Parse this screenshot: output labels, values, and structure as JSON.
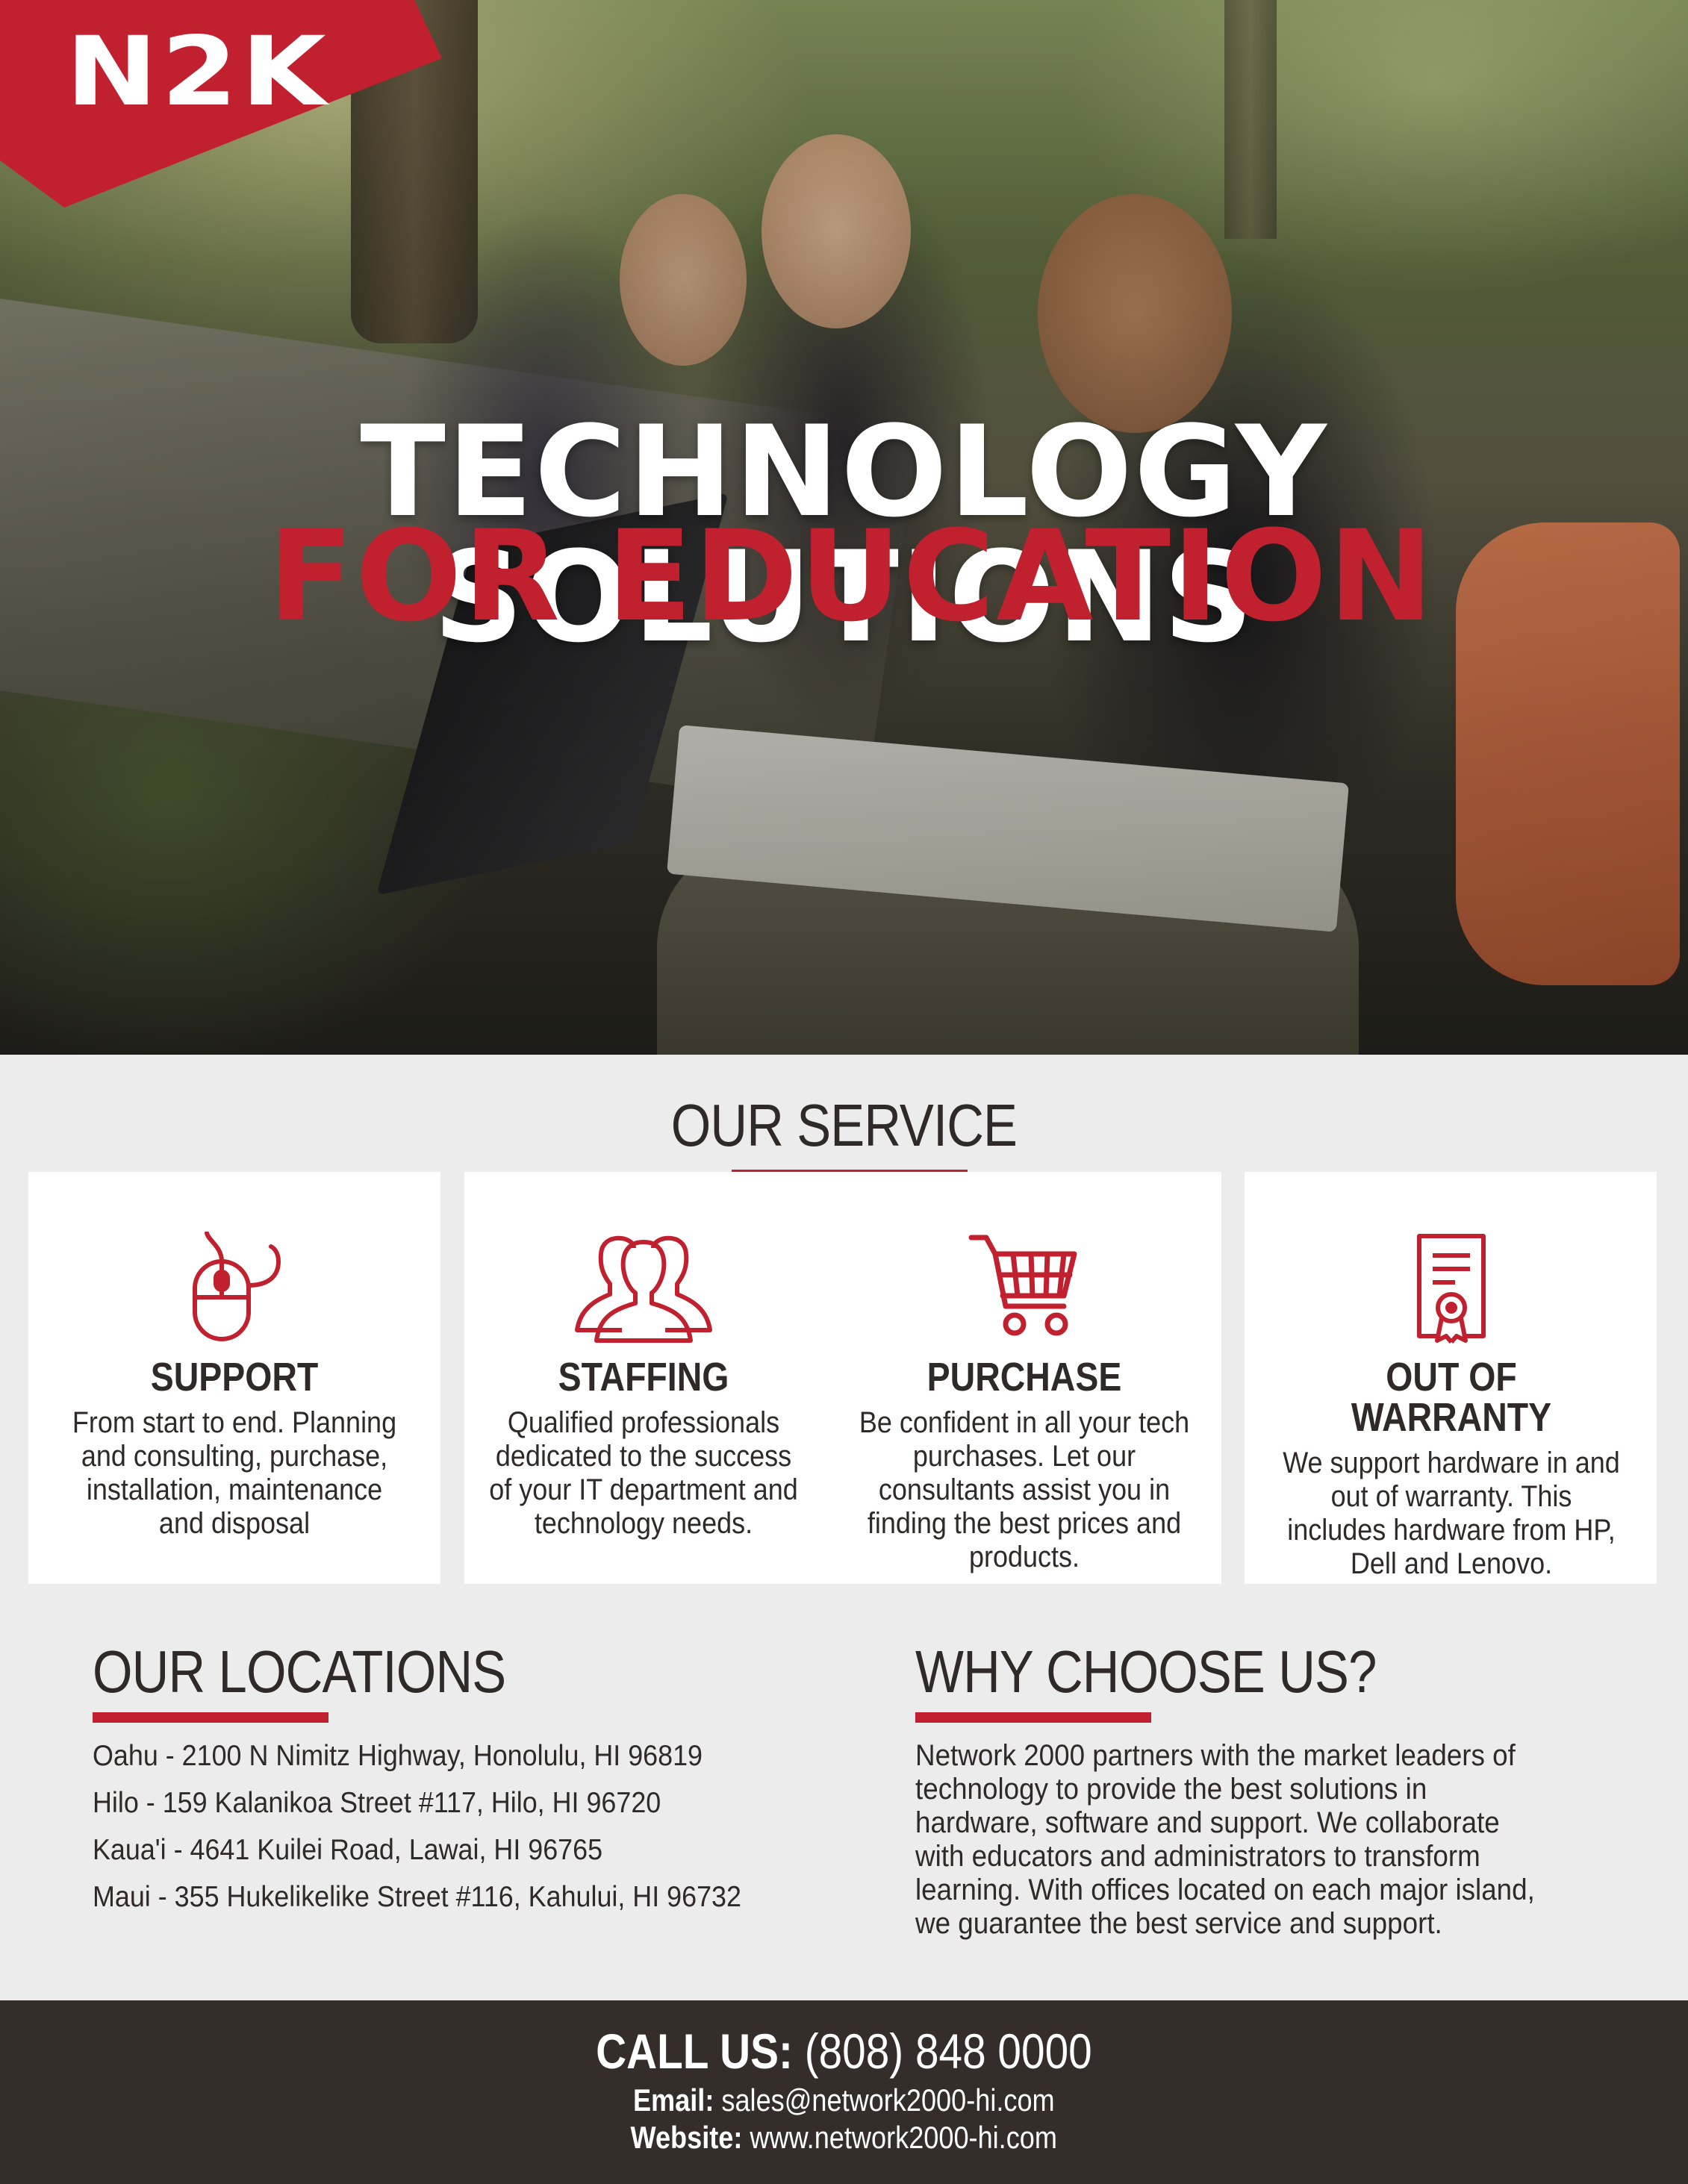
{
  "brand": {
    "logo_text": "N2K",
    "accent_color": "#c1202f",
    "dark_color": "#342d2a"
  },
  "hero": {
    "title": "TECHNOLOGY SOLUTIONS",
    "subtitle": "FOR EDUCATION"
  },
  "service": {
    "heading": "OUR SERVICE",
    "items": [
      {
        "icon": "mouse-icon",
        "title": "SUPPORT",
        "text": "From start to end. Planning and consulting, purchase, installation, maintenance and disposal"
      },
      {
        "icon": "people-icon",
        "title": "STAFFING",
        "text": "Qualified professionals dedicated to the success of your IT department and technology needs."
      },
      {
        "icon": "shopping-cart-icon",
        "title": "PURCHASE",
        "text": "Be confident in all your tech purchases. Let our consultants assist you in finding the best prices and products."
      },
      {
        "icon": "certificate-icon",
        "title": "OUT OF WARRANTY",
        "text": "We support hardware in and out of warranty. This includes hardware from HP, Dell and Lenovo."
      }
    ]
  },
  "locations": {
    "heading": "OUR LOCATIONS",
    "items": [
      "Oahu - 2100 N Nimitz Highway, Honolulu, HI 96819",
      "Hilo - 159 Kalanikoa Street #117, Hilo, HI 96720",
      "Kaua'i - 4641 Kuilei Road, Lawai, HI 96765",
      "Maui - 355 Hukelikelike Street #116, Kahului, HI 96732"
    ]
  },
  "why": {
    "heading": "WHY CHOOSE US?",
    "text": "Network 2000 partners with the market leaders of technology to provide the best solutions in hardware, software and support. We collaborate with educators and administrators to transform learning. With offices located on each major island, we guarantee the best service and support."
  },
  "footer": {
    "call_label": "CALL US:",
    "phone": "(808) 848 0000",
    "email_label": "Email:",
    "email": "sales@network2000-hi.com",
    "website_label": "Website:",
    "website": "www.network2000-hi.com"
  }
}
